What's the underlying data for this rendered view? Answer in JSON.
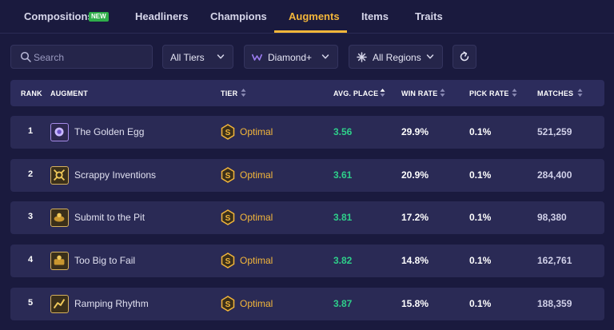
{
  "nav": {
    "tabs": [
      {
        "label": "Compositions"
      },
      {
        "label": "Headliners"
      },
      {
        "label": "Champions"
      },
      {
        "label": "Augments"
      },
      {
        "label": "Items"
      },
      {
        "label": "Traits"
      }
    ],
    "new_badge": "NEW",
    "active_tab": "Augments",
    "accent_color": "#f3b63a"
  },
  "filters": {
    "search_placeholder": "Search",
    "tiers": "All Tiers",
    "rank": "Diamond+",
    "regions": "All Regions"
  },
  "table": {
    "headers": {
      "rank": "RANK",
      "augment": "AUGMENT",
      "tier": "TIER",
      "avg_place": "AVG. PLACE",
      "win_rate": "WIN RATE",
      "pick_rate": "PICK RATE",
      "matches": "MATCHES"
    },
    "rows": [
      {
        "rank": "1",
        "augment": "The Golden Egg",
        "icon": "golden-egg-icon",
        "tier": "Optimal",
        "avg_place": "3.56",
        "win_rate": "29.9%",
        "pick_rate": "0.1%",
        "matches": "521,259"
      },
      {
        "rank": "2",
        "augment": "Scrappy Inventions",
        "icon": "scrappy-inventions-icon",
        "tier": "Optimal",
        "avg_place": "3.61",
        "win_rate": "20.9%",
        "pick_rate": "0.1%",
        "matches": "284,400"
      },
      {
        "rank": "3",
        "augment": "Submit to the Pit",
        "icon": "submit-to-the-pit-icon",
        "tier": "Optimal",
        "avg_place": "3.81",
        "win_rate": "17.2%",
        "pick_rate": "0.1%",
        "matches": "98,380"
      },
      {
        "rank": "4",
        "augment": "Too Big to Fail",
        "icon": "too-big-to-fail-icon",
        "tier": "Optimal",
        "avg_place": "3.82",
        "win_rate": "14.8%",
        "pick_rate": "0.1%",
        "matches": "162,761"
      },
      {
        "rank": "5",
        "augment": "Ramping Rhythm",
        "icon": "ramping-rhythm-icon",
        "tier": "Optimal",
        "avg_place": "3.87",
        "win_rate": "15.8%",
        "pick_rate": "0.1%",
        "matches": "188,359"
      }
    ]
  },
  "colors": {
    "background": "#1a1a3e",
    "good_value": "#2ecf8a",
    "tier": "#f3b63a"
  }
}
